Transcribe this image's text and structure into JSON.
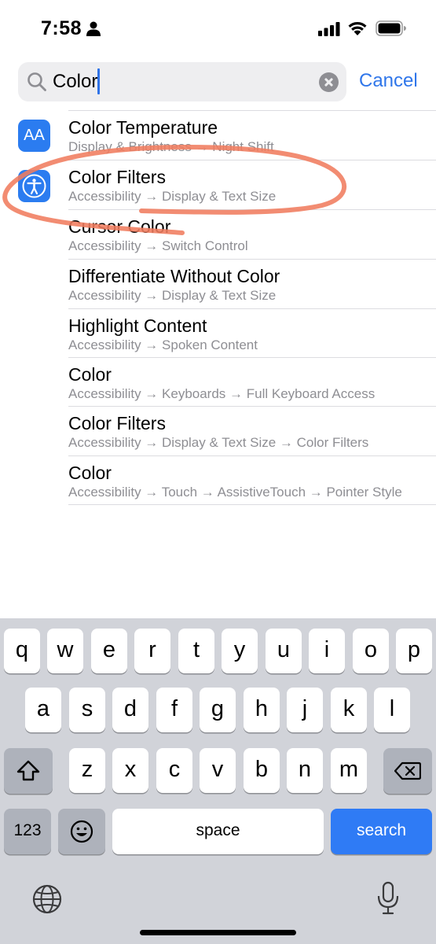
{
  "status_bar": {
    "time": "7:58",
    "person_icon": "person-icon",
    "signal_icon": "cellular-signal-icon",
    "wifi_icon": "wifi-icon",
    "battery_icon": "battery-icon"
  },
  "search": {
    "query": "Color",
    "search_icon": "magnifying-glass-icon",
    "clear_icon": "clear-x-icon",
    "cancel_label": "Cancel"
  },
  "results": [
    {
      "title": "Color Temperature",
      "subtitle": "Display & Brightness → Night Shift",
      "icon": "text-size-aa-icon",
      "icon_text": "AA"
    },
    {
      "title": "Color Filters",
      "subtitle": "Accessibility → Display & Text Size",
      "icon": "accessibility-icon"
    },
    {
      "title": "Cursor Color",
      "subtitle": "Accessibility → Switch Control"
    },
    {
      "title": "Differentiate Without Color",
      "subtitle": "Accessibility → Display & Text Size"
    },
    {
      "title": "Highlight Content",
      "subtitle": "Accessibility → Spoken Content"
    },
    {
      "title": "Color",
      "subtitle": "Accessibility → Keyboards → Full Keyboard Access"
    },
    {
      "title": "Color Filters",
      "subtitle": "Accessibility → Display & Text Size → Color Filters"
    },
    {
      "title": "Color",
      "subtitle": "Accessibility → Touch → AssistiveTouch → Pointer Style"
    }
  ],
  "colors": {
    "accent": "#2f76ea",
    "annotation": "#f07c5f",
    "icon_blue": "#2b7cf0",
    "keyboard_bg": "#d1d3d9"
  },
  "keyboard": {
    "row1": [
      "q",
      "w",
      "e",
      "r",
      "t",
      "y",
      "u",
      "i",
      "o",
      "p"
    ],
    "row2": [
      "a",
      "s",
      "d",
      "f",
      "g",
      "h",
      "j",
      "k",
      "l"
    ],
    "row3": [
      "z",
      "x",
      "c",
      "v",
      "b",
      "n",
      "m"
    ],
    "shift_icon": "shift-arrow-icon",
    "delete_icon": "delete-backspace-icon",
    "numbers_label": "123",
    "emoji_icon": "emoji-smiley-icon",
    "space_label": "space",
    "search_label": "search",
    "globe_icon": "globe-icon",
    "mic_icon": "microphone-icon"
  }
}
